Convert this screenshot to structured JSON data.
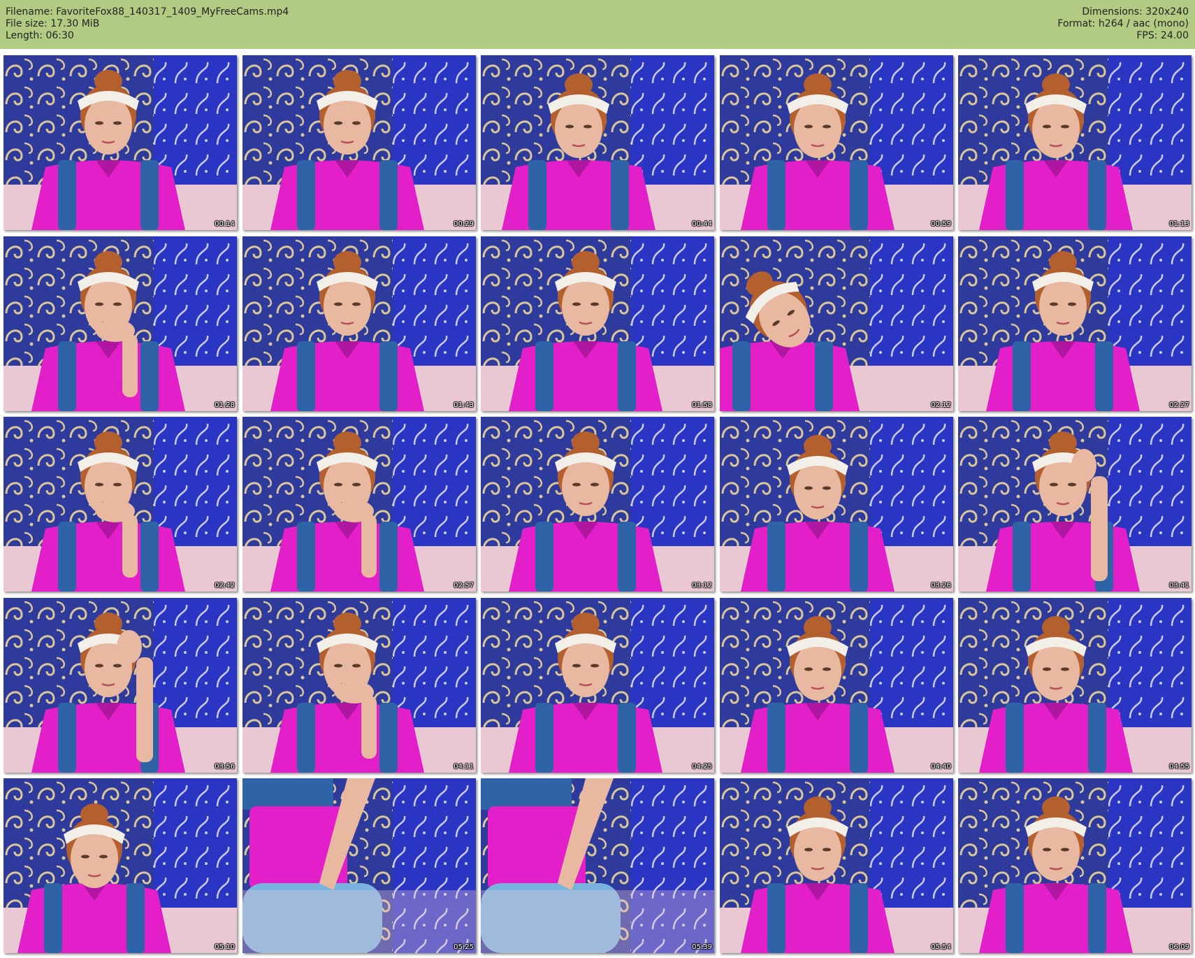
{
  "header": {
    "filename_line": "Filename: FavoriteFox88_140317_1409_MyFreeCams.mp4",
    "filesize_line": "File size: 17.30 MiB",
    "length_line": "Length: 06:30",
    "dimensions_line": "Dimensions: 320x240",
    "format_line": "Format: h264 / aac (mono)",
    "fps_line": "FPS: 24.00"
  },
  "colors": {
    "header_bg": "#b1cc82",
    "wallpaper_blue": "#2e3a9c",
    "wallpaper_pattern": "#d9c79a",
    "shirt_pink": "#e21fc8",
    "vest_denim": "#2f63a8",
    "skin": "#e8b8a0",
    "hair": "#b4602e",
    "headband": "#f2eee8",
    "table_pink": "#e9c7d3",
    "leggings_blue": "#78b4de"
  },
  "thumbnails": [
    {
      "time": "00:14",
      "scene": "head-down"
    },
    {
      "time": "00:29",
      "scene": "head-down"
    },
    {
      "time": "00:44",
      "scene": "frontal"
    },
    {
      "time": "00:59",
      "scene": "frontal"
    },
    {
      "time": "01:13",
      "scene": "frontal"
    },
    {
      "time": "01:28",
      "scene": "hand-chin"
    },
    {
      "time": "01:43",
      "scene": "head-down"
    },
    {
      "time": "01:58",
      "scene": "head-down"
    },
    {
      "time": "02:12",
      "scene": "tilted"
    },
    {
      "time": "02:27",
      "scene": "head-down"
    },
    {
      "time": "02:42",
      "scene": "hand-chin"
    },
    {
      "time": "02:57",
      "scene": "hand-chin"
    },
    {
      "time": "03:12",
      "scene": "head-down"
    },
    {
      "time": "03:26",
      "scene": "frontal"
    },
    {
      "time": "03:41",
      "scene": "hand-head"
    },
    {
      "time": "03:56",
      "scene": "hand-head"
    },
    {
      "time": "04:11",
      "scene": "hand-chin"
    },
    {
      "time": "04:25",
      "scene": "head-down"
    },
    {
      "time": "04:40",
      "scene": "frontal"
    },
    {
      "time": "04:55",
      "scene": "frontal"
    },
    {
      "time": "05:10",
      "scene": "frontal-far"
    },
    {
      "time": "05:25",
      "scene": "standing"
    },
    {
      "time": "05:39",
      "scene": "standing"
    },
    {
      "time": "05:54",
      "scene": "frontal"
    },
    {
      "time": "06:09",
      "scene": "frontal"
    }
  ]
}
